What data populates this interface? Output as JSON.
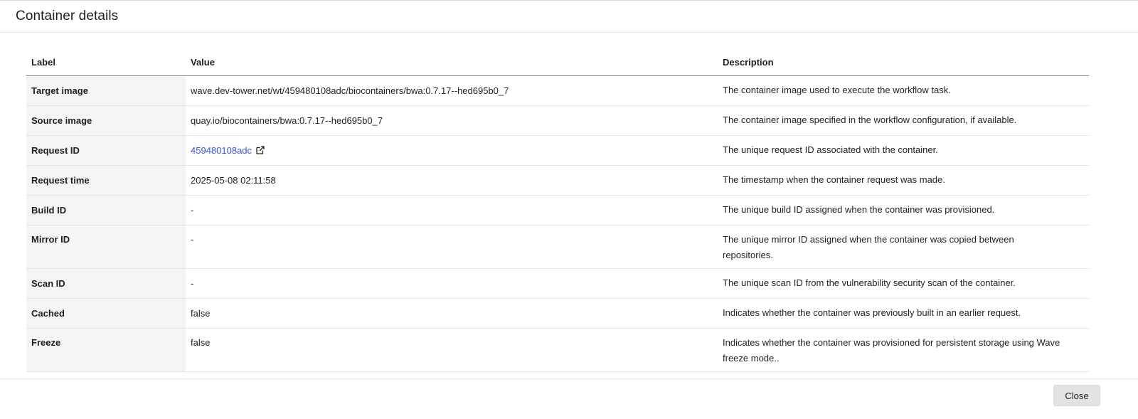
{
  "dialog": {
    "title": "Container details",
    "close_label": "Close"
  },
  "table": {
    "headers": {
      "label": "Label",
      "value": "Value",
      "description": "Description"
    },
    "rows": [
      {
        "label": "Target image",
        "value": "wave.dev-tower.net/wt/459480108adc/biocontainers/bwa:0.7.17--hed695b0_7",
        "description": [
          "The container image used to execute the workflow task."
        ]
      },
      {
        "label": "Source image",
        "value": "quay.io/biocontainers/bwa:0.7.17--hed695b0_7",
        "description": [
          "The container image specified in the workflow configuration, if available."
        ]
      },
      {
        "label": "Request ID",
        "value": "459480108adc",
        "description": [
          "The unique request ID associated with the container."
        ]
      },
      {
        "label": "Request time",
        "value": "2025-05-08 02:11:58",
        "description": [
          "The timestamp when the container request was made."
        ]
      },
      {
        "label": "Build ID",
        "value": "-",
        "description": [
          "The unique build ID assigned when the container was provisioned."
        ]
      },
      {
        "label": "Mirror ID",
        "value": "-",
        "description": [
          "The unique mirror ID assigned when the container was copied between",
          "repositories."
        ]
      },
      {
        "label": "Scan ID",
        "value": "-",
        "description": [
          "The unique scan ID from the vulnerability security scan of the container."
        ]
      },
      {
        "label": "Cached",
        "value": "false",
        "description": [
          "Indicates whether the container was previously built in an earlier request."
        ]
      },
      {
        "label": "Freeze",
        "value": "false",
        "description": [
          "Indicates whether the container was provisioned for persistent storage using Wave",
          "freeze mode.."
        ]
      }
    ]
  },
  "colors": {
    "link": "#3b55d9",
    "label_column_bg": "#f4f4f4",
    "close_button_bg": "#e3e3e3"
  },
  "icons": {
    "request_id_link": "external-link-icon"
  }
}
